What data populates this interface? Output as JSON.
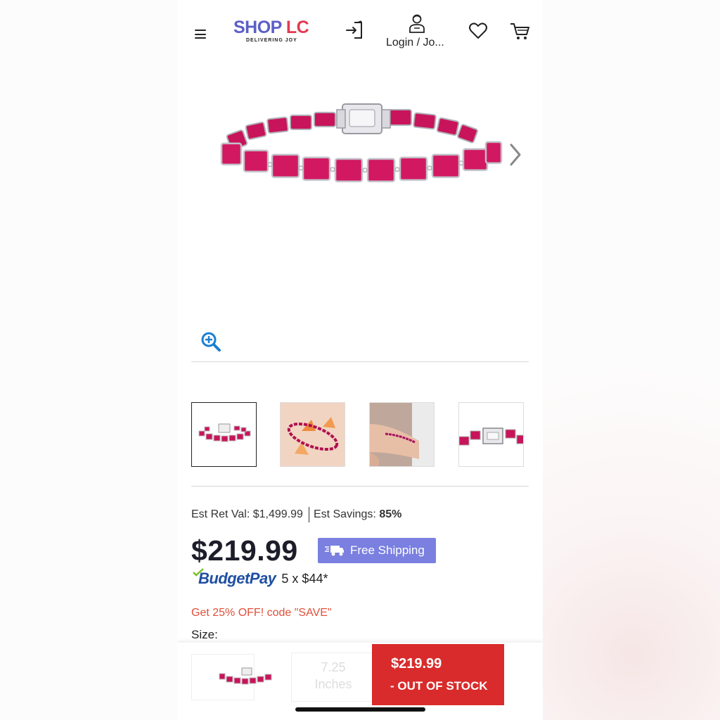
{
  "header": {
    "logo_shop": "SHOP",
    "logo_lc": "LC",
    "logo_tagline": "DELIVERING JOY",
    "login_label": "Login / Jo...",
    "icons": [
      "menu-icon",
      "sign-in-icon",
      "user-icon",
      "heart-icon",
      "cart-icon"
    ]
  },
  "gallery": {
    "main_image": "ruby tennis bracelet",
    "thumbnails": [
      {
        "name": "bracelet-front",
        "active": true
      },
      {
        "name": "bracelet-on-display",
        "active": false
      },
      {
        "name": "bracelet-on-wrist",
        "active": false
      },
      {
        "name": "bracelet-clasp-closeup",
        "active": false
      }
    ]
  },
  "pricing": {
    "est_ret_label": "Est Ret Val:",
    "est_ret_value": "$1,499.99",
    "est_savings_label": "Est Savings:",
    "est_savings_value": "85%",
    "price": "$219.99",
    "free_shipping": "Free Shipping",
    "budgetpay_logo": "BudgetPay",
    "budgetpay_terms": "5 x $44*",
    "promo": "Get 25% OFF! code \"SAVE\"",
    "size_label": "Size:"
  },
  "bottom_bar": {
    "size_value_line1": "7.25",
    "size_value_line2": "Inches",
    "price": "$219.99",
    "status": "- OUT OF STOCK"
  },
  "colors": {
    "brand_blue": "#5b5fc7",
    "brand_red": "#e23a52",
    "shipping_badge": "#7a7fe0",
    "promo_text": "#e0503a",
    "buy_button": "#d92b2b",
    "ruby": "#c8145a"
  }
}
